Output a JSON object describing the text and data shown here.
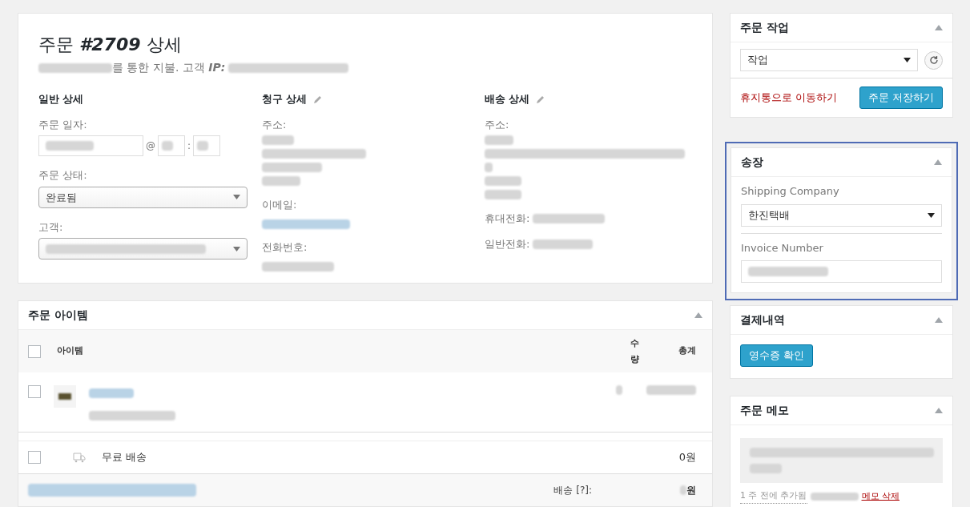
{
  "order": {
    "title": "주문 **#2709** 상세",
    "subtitle": "를 통한 지불. 고객 **IP:**",
    "general": {
      "heading": "일반 상세",
      "date_label": "주문 일자:",
      "at": "@",
      "colon": ":",
      "status_label": "주문 상태:",
      "status_value": "완료됨",
      "customer_label": "고객:"
    },
    "billing": {
      "heading": "청구 상세",
      "address_label": "주소:",
      "email_label": "이메일:",
      "phone_label": "전화번호:"
    },
    "shipping": {
      "heading": "배송 상세",
      "address_label": "주소:",
      "mobile_label": "휴대전화:",
      "phone_label": "일반전화:"
    }
  },
  "items": {
    "title": "주문 아이템",
    "select_all_checked": false,
    "columns": [
      "아이템",
      "수량",
      "총계"
    ],
    "rows": [
      {
        "kind": "product",
        "checked": false
      },
      {
        "kind": "shipping",
        "checked": false,
        "name": "무료 배송",
        "total": "0원"
      }
    ],
    "footer": {
      "label": "배송 [?]:",
      "value": "원"
    }
  },
  "actions": {
    "title": "주문 작업",
    "select": "작업",
    "trash": "휴지통으로 이동하기",
    "save": "주문 저장하기"
  },
  "invoice": {
    "title": "송장",
    "company_label": "Shipping Company",
    "company_value": "한진택배",
    "number_label": "Invoice Number"
  },
  "payment": {
    "title": "결제내역",
    "button": "영수증 확인"
  },
  "notes": {
    "title": "주문 메모",
    "meta": "1 주 전에 추가됨",
    "delete": "메모 삭제"
  }
}
